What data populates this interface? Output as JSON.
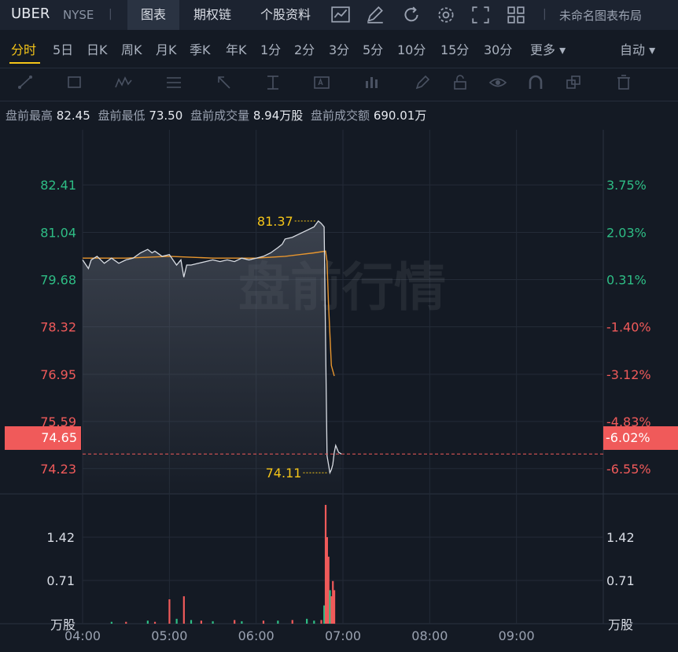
{
  "header": {
    "symbol": "UBER",
    "exchange": "NYSE",
    "separator": "|",
    "tabs": [
      {
        "label": "图表"
      },
      {
        "label": "期权链"
      },
      {
        "label": "个股资料"
      }
    ],
    "layout_label": "未命名图表布局"
  },
  "periods": [
    "分时",
    "5日",
    "日K",
    "周K",
    "月K",
    "季K",
    "年K",
    "1分",
    "2分",
    "3分",
    "5分",
    "10分",
    "15分",
    "30分",
    "更多 ▾"
  ],
  "active_period": "分时",
  "auto_label": "自动 ▾",
  "stats": {
    "high_label": "盘前最高",
    "high_value": "82.45",
    "low_label": "盘前最低",
    "low_value": "73.50",
    "vol_label": "盘前成交量",
    "vol_value": "8.94万股",
    "amt_label": "盘前成交额",
    "amt_value": "690.01万"
  },
  "watermark": "盘前行情",
  "colors": {
    "up": "#2ebd85",
    "down": "#f05a5a",
    "avg_line": "#e8962e",
    "price_line": "#d9dde4",
    "accent": "#f5c518"
  },
  "current": {
    "price": "74.65",
    "change": "-6.02%"
  },
  "chart_data": {
    "type": "line",
    "x_ticks": [
      "04:00",
      "05:00",
      "06:00",
      "07:00",
      "08:00",
      "09:00"
    ],
    "xlim": [
      "04:00",
      "10:00"
    ],
    "price_axis": {
      "left_ticks": [
        "82.41",
        "81.04",
        "79.68",
        "78.32",
        "76.95",
        "75.59",
        "74.23"
      ],
      "right_ticks": [
        "3.75%",
        "2.03%",
        "0.31%",
        "-1.40%",
        "-3.12%",
        "-4.83%",
        "-6.55%"
      ],
      "ylim": [
        73.5,
        84.0
      ]
    },
    "volume_axis": {
      "ticks": [
        "1.42",
        "0.71"
      ],
      "unit": "万股",
      "ylim": [
        0,
        2.13
      ]
    },
    "annotations": {
      "max": "81.37",
      "min": "74.11"
    },
    "price": {
      "x": [
        "04:00",
        "04:04",
        "04:06",
        "04:10",
        "04:15",
        "04:20",
        "04:25",
        "04:30",
        "04:35",
        "04:40",
        "04:45",
        "04:48",
        "04:50",
        "04:55",
        "05:00",
        "05:05",
        "05:08",
        "05:10",
        "05:12",
        "05:15",
        "05:20",
        "05:25",
        "05:30",
        "05:35",
        "05:40",
        "05:45",
        "05:50",
        "05:55",
        "06:00",
        "06:05",
        "06:10",
        "06:15",
        "06:18",
        "06:20",
        "06:25",
        "06:30",
        "06:35",
        "06:40",
        "06:43",
        "06:45",
        "06:47",
        "06:49",
        "06:51",
        "06:52",
        "06:53",
        "06:54",
        "06:55",
        "06:56",
        "06:57",
        "06:59"
      ],
      "y": [
        80.25,
        80.0,
        80.25,
        80.35,
        80.15,
        80.3,
        80.15,
        80.25,
        80.3,
        80.45,
        80.55,
        80.45,
        80.5,
        80.35,
        80.4,
        80.1,
        80.25,
        79.75,
        80.1,
        80.1,
        80.15,
        80.2,
        80.25,
        80.2,
        80.25,
        80.2,
        80.3,
        80.25,
        80.3,
        80.35,
        80.45,
        80.6,
        80.7,
        80.85,
        80.9,
        81.0,
        81.1,
        81.2,
        81.37,
        81.3,
        81.2,
        74.6,
        74.11,
        74.2,
        74.35,
        74.7,
        74.9,
        74.8,
        74.7,
        74.65
      ]
    },
    "avg": {
      "x": [
        "04:00",
        "04:30",
        "05:00",
        "05:30",
        "06:00",
        "06:20",
        "06:40",
        "06:48",
        "06:49",
        "06:50",
        "06:52",
        "06:54"
      ],
      "y": [
        80.3,
        80.3,
        80.35,
        80.3,
        80.3,
        80.35,
        80.45,
        80.5,
        80.2,
        79.0,
        77.2,
        76.9
      ]
    },
    "volume": {
      "x": [
        "04:20",
        "04:30",
        "04:45",
        "04:50",
        "05:00",
        "05:05",
        "05:10",
        "05:15",
        "05:22",
        "05:30",
        "05:45",
        "05:50",
        "06:05",
        "06:15",
        "06:25",
        "06:35",
        "06:40",
        "06:45",
        "06:47",
        "06:48",
        "06:49",
        "06:50",
        "06:51",
        "06:52",
        "06:53",
        "06:54"
      ],
      "y": [
        0.03,
        0.03,
        0.05,
        0.03,
        0.4,
        0.08,
        0.45,
        0.06,
        0.05,
        0.04,
        0.06,
        0.04,
        0.05,
        0.05,
        0.06,
        0.08,
        0.05,
        0.06,
        0.3,
        1.95,
        1.42,
        1.1,
        0.55,
        0.45,
        0.7,
        0.55
      ],
      "color": [
        "up",
        "down",
        "up",
        "down",
        "down",
        "up",
        "down",
        "up",
        "down",
        "up",
        "down",
        "up",
        "down",
        "up",
        "down",
        "up",
        "up",
        "down",
        "up",
        "down",
        "down",
        "down",
        "up",
        "down",
        "down",
        "down"
      ]
    }
  }
}
